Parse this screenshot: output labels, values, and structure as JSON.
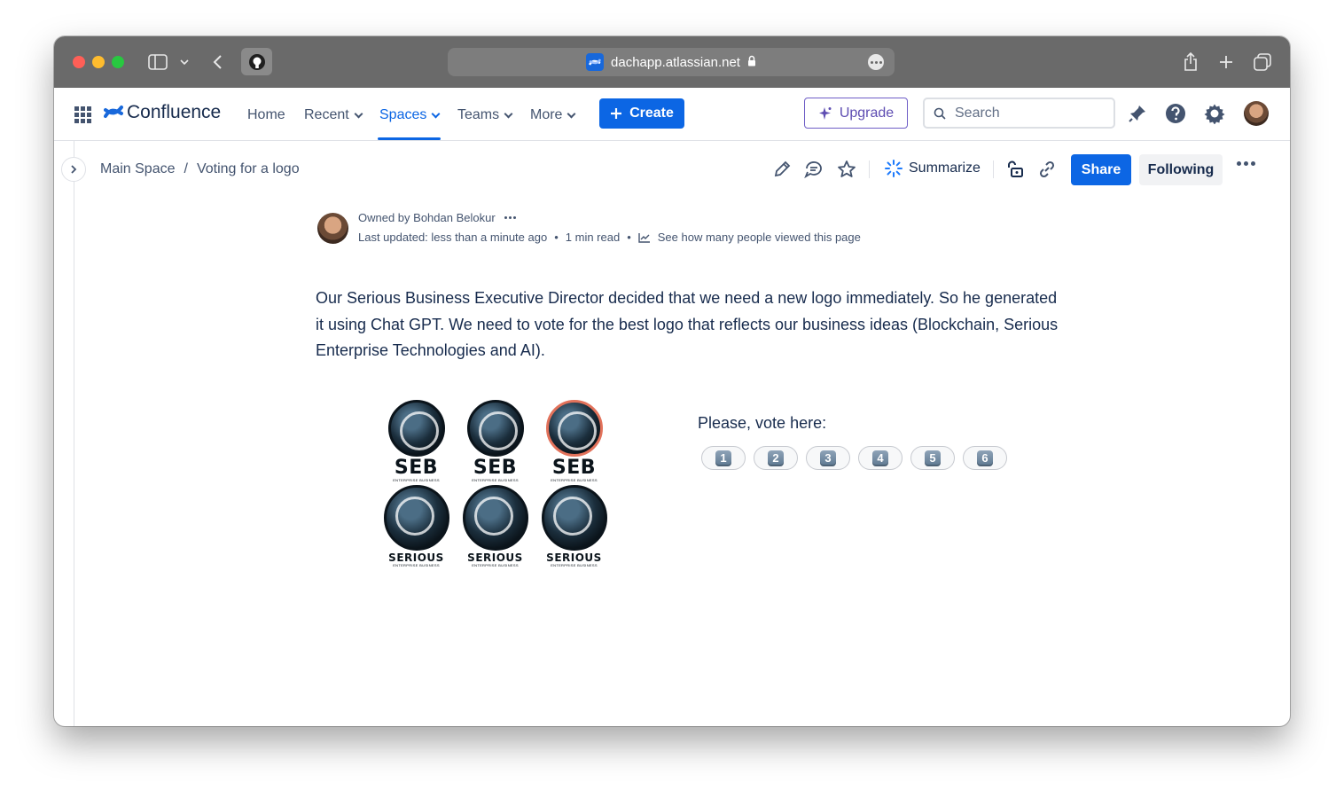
{
  "browser": {
    "url": "dachapp.atlassian.net"
  },
  "topnav": {
    "product_name": "Confluence",
    "items": [
      {
        "label": "Home"
      },
      {
        "label": "Recent"
      },
      {
        "label": "Spaces"
      },
      {
        "label": "Teams"
      },
      {
        "label": "More"
      }
    ],
    "active_item": "Spaces",
    "create_label": "Create",
    "upgrade_label": "Upgrade",
    "search_placeholder": "Search",
    "accent_color": "#0c66e4"
  },
  "toolbar": {
    "breadcrumb": [
      "Main Space",
      "/",
      "Voting for a logo"
    ],
    "summarize_label": "Summarize",
    "share_label": "Share",
    "following_label": "Following"
  },
  "byline": {
    "owner": "Owned by Bohdan Belokur",
    "last_updated": "Last updated: less than a minute ago",
    "separator": "•",
    "read_time": "1 min read",
    "views_link": "See how many people viewed this page"
  },
  "content": {
    "paragraph": "Our Serious Business Executive Director decided that we need a new logo immediately. So he generated it using Chat GPT. We need to vote for  the best logo that reflects our business ideas (Blockchain, Serious Enterprise Technologies and AI).",
    "logos": [
      {
        "wordmark": "SEB",
        "tagline": "ENTERPRISE BUSINESS"
      },
      {
        "wordmark": "SEB",
        "tagline": "ENTERPRISE BUSINESS"
      },
      {
        "wordmark": "SEB",
        "tagline": "ENTERPRISE BUSINESS"
      },
      {
        "wordmark": "SERIOUS",
        "tagline": "ENTERPRISE BUSINESS"
      },
      {
        "wordmark": "SERIOUS",
        "tagline": "ENTERPRISE BUSINESS"
      },
      {
        "wordmark": "SERIOUS",
        "tagline": "ENTERPRISE BUSINESS"
      }
    ],
    "vote_label": "Please, vote here:",
    "vote_options": [
      "1",
      "2",
      "3",
      "4",
      "5",
      "6"
    ]
  }
}
